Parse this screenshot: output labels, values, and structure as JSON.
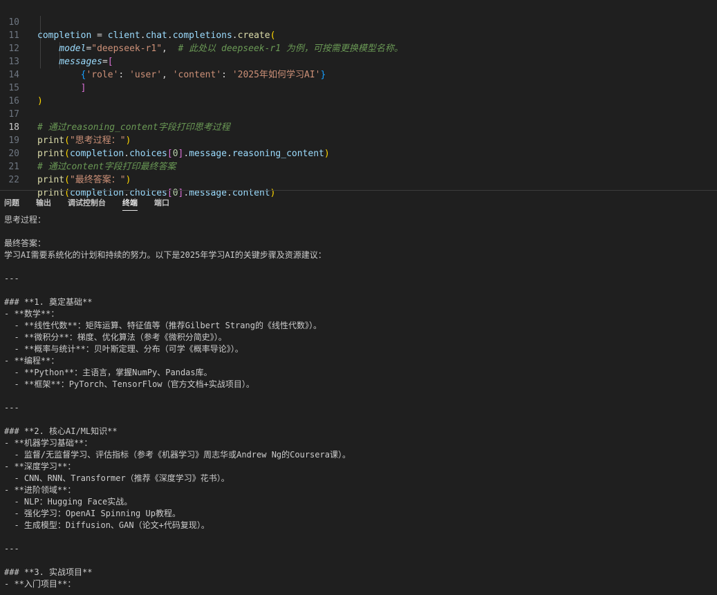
{
  "editor": {
    "active_line": "18",
    "lines": [
      {
        "n": "10"
      },
      {
        "n": "11"
      },
      {
        "n": "12"
      },
      {
        "n": "13"
      },
      {
        "n": "14"
      },
      {
        "n": "15"
      },
      {
        "n": "16"
      },
      {
        "n": "17"
      },
      {
        "n": "18"
      },
      {
        "n": "19"
      },
      {
        "n": "20"
      },
      {
        "n": "21"
      },
      {
        "n": "22"
      }
    ],
    "tokens": {
      "completion": "completion",
      "eq": " = ",
      "client": "client",
      "dot": ".",
      "chat": "chat",
      "completions": "completions",
      "create": "create",
      "paren_open": "(",
      "paren_close": ")",
      "model_kw": "model",
      "model_val": "\"deepseek-r1\"",
      "comma": ",",
      "comment_model": "# 此处以 deepseek-r1 为例，可按需更换模型名称。",
      "messages_kw": "messages",
      "br_open": "[",
      "br_close": "]",
      "brace_open": "{",
      "brace_close": "}",
      "role_key": "'role'",
      "colon": ": ",
      "role_val": "'user'",
      "content_key": "'content'",
      "content_val": "'2025年如何学习AI'",
      "comment_reasoning": "# 通过reasoning_content字段打印思考过程",
      "print": "print",
      "str_think": "\"思考过程：\"",
      "choices": "choices",
      "zero": "0",
      "message": "message",
      "reasoning_content": "reasoning_content",
      "comment_content": "# 通过content字段打印最终答案",
      "str_final": "\"最终答案：\"",
      "content": "content"
    }
  },
  "panel": {
    "tabs": [
      {
        "label": "问题"
      },
      {
        "label": "输出"
      },
      {
        "label": "调试控制台"
      },
      {
        "label": "终端"
      },
      {
        "label": "端口"
      }
    ],
    "active_tab": "终端"
  },
  "terminal": {
    "lines": [
      "思考过程：",
      "",
      "最终答案：",
      "学习AI需要系统化的计划和持续的努力。以下是2025年学习AI的关键步骤及资源建议：",
      "",
      "---",
      "",
      "### **1. 奠定基础**",
      "- **数学**：",
      "  - **线性代数**：矩阵运算、特征值等（推荐Gilbert Strang的《线性代数》）。",
      "  - **微积分**：梯度、优化算法（参考《微积分简史》）。",
      "  - **概率与统计**：贝叶斯定理、分布（可学《概率导论》）。",
      "- **编程**：",
      "  - **Python**：主语言，掌握NumPy、Pandas库。",
      "  - **框架**：PyTorch、TensorFlow（官方文档+实战项目）。",
      "",
      "---",
      "",
      "### **2. 核心AI/ML知识**",
      "- **机器学习基础**：",
      "  - 监督/无监督学习、评估指标（参考《机器学习》周志华或Andrew Ng的Coursera课）。",
      "- **深度学习**：",
      "  - CNN、RNN、Transformer（推荐《深度学习》花书）。",
      "- **进阶领域**：",
      "  - NLP：Hugging Face实战。",
      "  - 强化学习：OpenAI Spinning Up教程。",
      "  - 生成模型：Diffusion、GAN（论文+代码复现）。",
      "",
      "---",
      "",
      "### **3. 实战项目**",
      "- **入门项目**："
    ]
  }
}
